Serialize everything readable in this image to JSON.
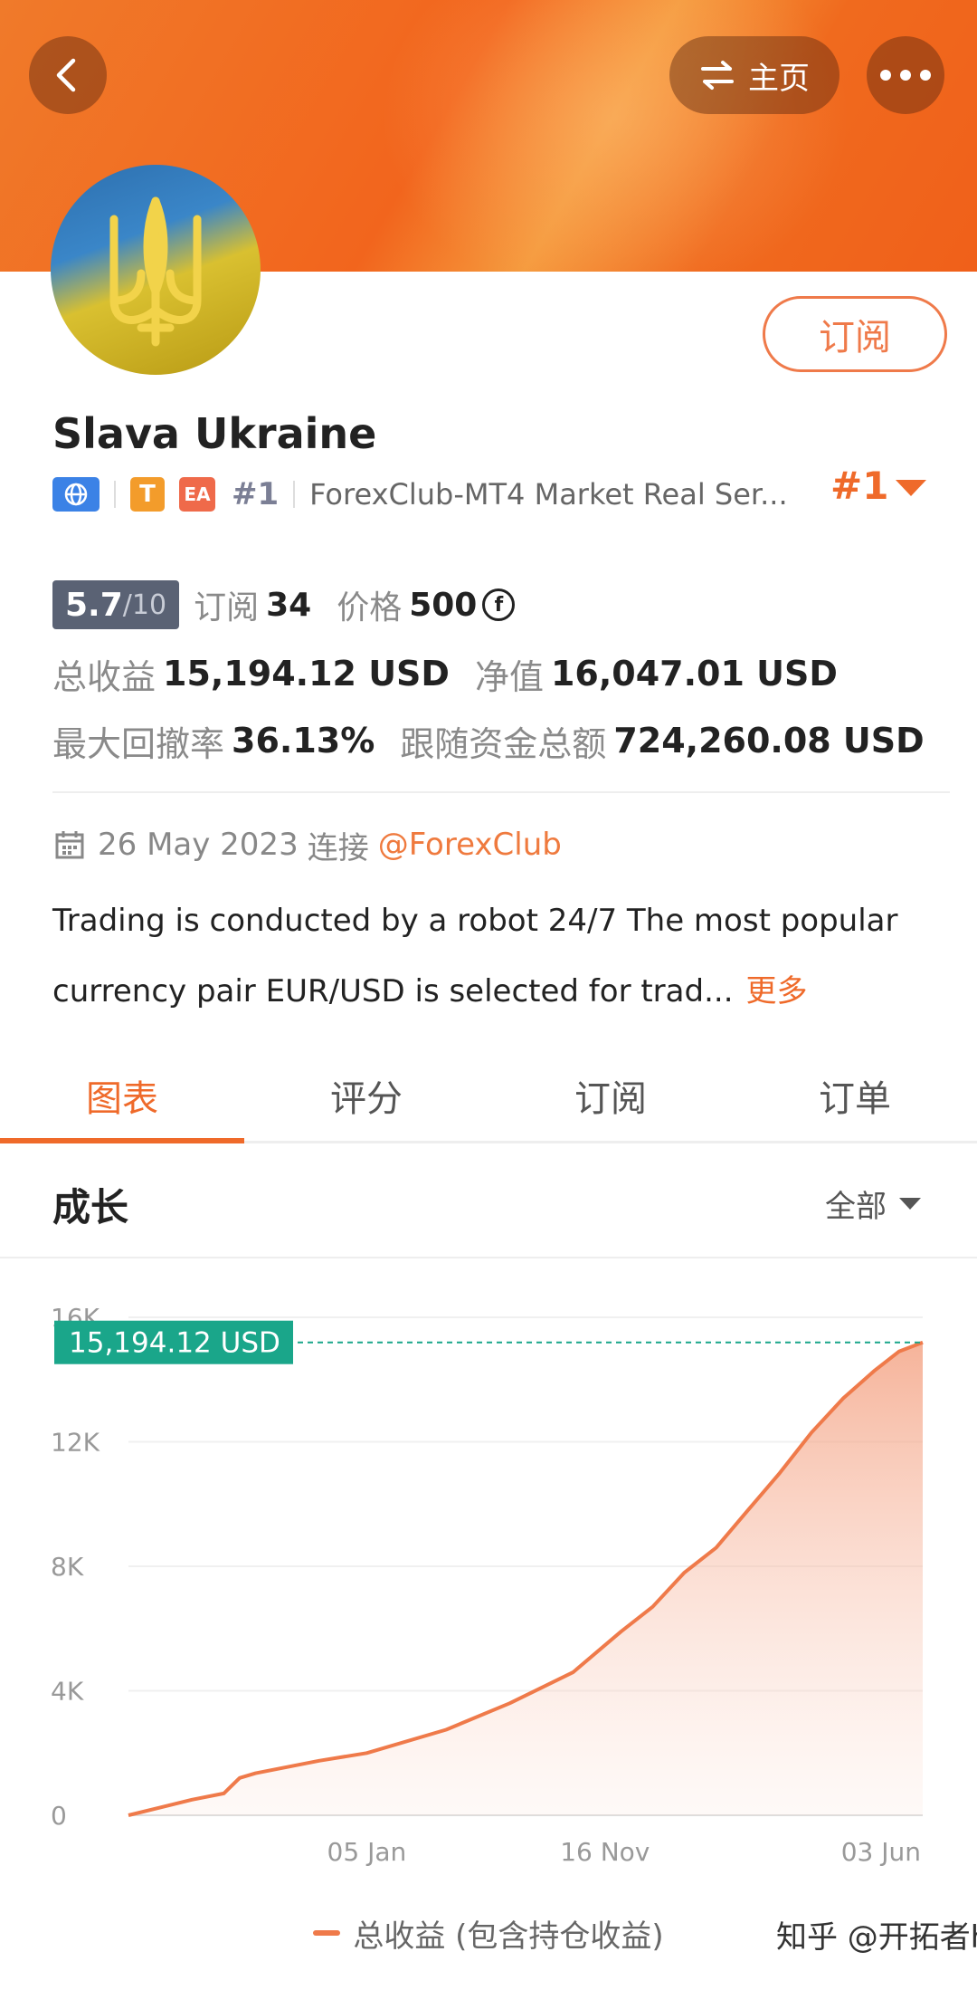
{
  "header": {
    "home_label": "主页",
    "subscribe_label": "订阅"
  },
  "profile": {
    "name": "Slava Ukraine",
    "tag_t": "T",
    "tag_ea": "EA",
    "rank_small": "#1",
    "server": "ForexClub-MT4 Market Real Ser...",
    "rank_big": "#1"
  },
  "stats": {
    "score": "5.7",
    "score_denom": "/10",
    "subs_label": "订阅",
    "subs_value": "34",
    "price_label": "价格",
    "price_value": "500",
    "price_coin": "f",
    "total_profit_label": "总收益",
    "total_profit_value": "15,194.12 USD",
    "equity_label": "净值",
    "equity_value": "16,047.01 USD",
    "max_dd_label": "最大回撤率",
    "max_dd_value": "36.13%",
    "followers_label": "跟随资金总额",
    "followers_value": "724,260.08 USD"
  },
  "info": {
    "date": "26 May 2023",
    "connect_label": "连接",
    "creator": "@ForexClub",
    "description": "Trading is conducted by a robot 24/7 The most popular currency pair EUR/USD is selected for trad...",
    "more_label": "更多"
  },
  "tabs": [
    "图表",
    "评分",
    "订阅",
    "订单"
  ],
  "section": {
    "title": "成长",
    "range": "全部"
  },
  "colors": {
    "accent": "#ef6a2a",
    "line": "#ef7a4a",
    "badge": "#1aa68a"
  },
  "chart_data": {
    "type": "area",
    "yticks": [
      "16K",
      "12K",
      "8K",
      "4K",
      "0"
    ],
    "ylim": [
      0,
      16000
    ],
    "xticks": [
      "05 Jan",
      "16 Nov",
      "03 Jun"
    ],
    "x": [
      0,
      4,
      8,
      12,
      14,
      16,
      20,
      24,
      30,
      40,
      48,
      56,
      62,
      66,
      70,
      74,
      78,
      82,
      86,
      90,
      94,
      97,
      100
    ],
    "series": [
      {
        "name": "总收益 (包含持仓收益)",
        "values": [
          0,
          250,
          500,
          700,
          1200,
          1350,
          1550,
          1750,
          2000,
          2750,
          3600,
          4600,
          5900,
          6700,
          7800,
          8600,
          9800,
          11000,
          12300,
          13400,
          14300,
          14900,
          15194.12
        ]
      }
    ],
    "current_value_label": "15,194.12 USD",
    "legend": "总收益 (包含持仓收益)"
  },
  "watermark": "知乎 @开拓者h"
}
